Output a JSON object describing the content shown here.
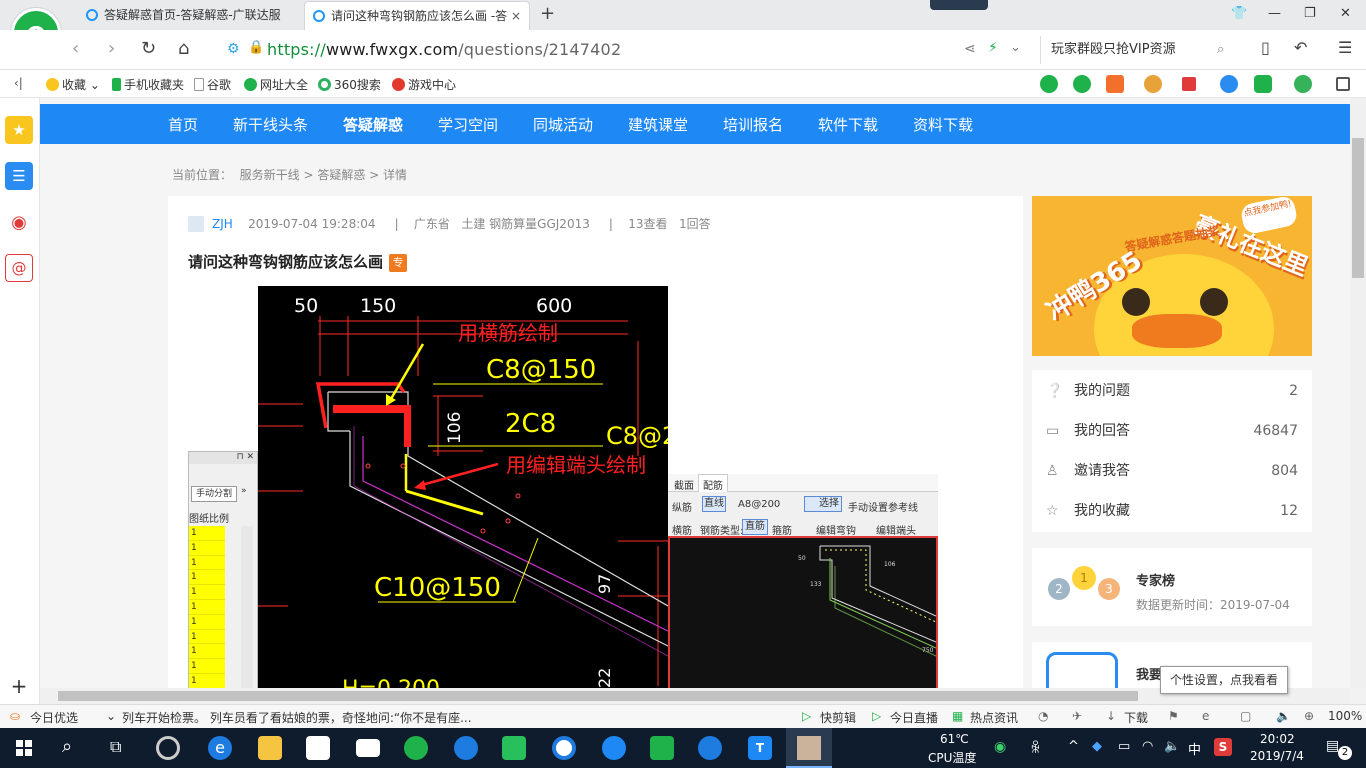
{
  "browser": {
    "tabs": [
      {
        "title": "答疑解惑首页-答疑解惑-广联达服"
      },
      {
        "title": "请问这种弯钩钢筋应该怎么画 -答"
      }
    ],
    "url_scheme": "https://",
    "url_domain": "www.fwxgx.com",
    "url_path": "/questions/2147402",
    "search_text": "玩家群殴只抢VIP资源",
    "favorites": [
      "收藏",
      "手机收藏夹",
      "谷歌",
      "网址大全",
      "360搜索",
      "游戏中心"
    ]
  },
  "site_nav": [
    "首页",
    "新干线头条",
    "答疑解惑",
    "学习空间",
    "同城活动",
    "建筑课堂",
    "培训报名",
    "软件下载",
    "资料下载"
  ],
  "breadcrumb": {
    "label": "当前位置：",
    "path": "服务新干线 > 答疑解惑 > 详情"
  },
  "question": {
    "author": "ZJH",
    "datetime": "2019-07-04 19:28:04",
    "location": "广东省",
    "category": "土建 钢筋算量GGJ2013",
    "views": "13查看",
    "answers": "1回答",
    "title": "请问这种弯钩钢筋应该怎么画",
    "badge": "专"
  },
  "cad": {
    "dim_50": "50",
    "dim_150": "150",
    "dim_600": "600",
    "note1": "用横筋绘制",
    "label_c8_150": "C8@150",
    "label_106": "106",
    "label_2c8": "2C8",
    "label_c8_2": "C8@2",
    "note2": "用编辑端头绘制",
    "label_c10": "C10@150",
    "label_97": "97",
    "label_22": "22",
    "label_h": "H=0.200",
    "panel_btn": "手动分割",
    "panel_col": "图纸比例",
    "panel_rows": [
      "1",
      "1",
      "1",
      "1",
      "1",
      "1",
      "1",
      "1",
      "1",
      "1",
      "1",
      "1"
    ],
    "sw_tabs": [
      "截面",
      "配筋"
    ],
    "sw_row1": {
      "lbl": "纵筋",
      "btn": "直线",
      "val": "A8@200",
      "select": "选择",
      "ref": "手动设置参考线"
    },
    "sw_row2": {
      "lbl": "横筋",
      "type": "钢筋类型:",
      "t1": "直筋",
      "t2": "箍筋",
      "e1": "编辑弯钩",
      "e2": "编辑端头"
    },
    "sw_dims": [
      "50",
      "106",
      "133",
      "750"
    ]
  },
  "ad": {
    "line1": "冲鸭365",
    "line2": "豪礼在这里",
    "line3": "答疑解惑答题抽奖",
    "badge": "点我参加鸭!"
  },
  "user_menu": [
    {
      "label": "我的问题",
      "count": "2",
      "icon": "question-icon"
    },
    {
      "label": "我的回答",
      "count": "46847",
      "icon": "comment-icon"
    },
    {
      "label": "邀请我答",
      "count": "804",
      "icon": "user-icon"
    },
    {
      "label": "我的收藏",
      "count": "12",
      "icon": "star-icon"
    }
  ],
  "expert": {
    "title": "专家榜",
    "updated": "数据更新时间：2019-07-04",
    "ranks": [
      "2",
      "1",
      "3"
    ]
  },
  "expert2": {
    "title": "我要"
  },
  "tooltip": "个性设置，点我看看",
  "statusbar": {
    "left": "今日优选",
    "news": "列车开始检票。 列车员看了看姑娘的票，奇怪地问:“你不是有座...",
    "items": [
      "快剪辑",
      "今日直播",
      "热点资讯",
      "下载"
    ],
    "zoom": "100%"
  },
  "taskbar": {
    "temp": "61℃",
    "temp_label": "CPU温度",
    "ime": "中",
    "time": "20:02",
    "date": "2019/7/4",
    "notif": "2"
  },
  "colors": {
    "nav_blue": "#1e88f5",
    "accent_green": "#1fb24a",
    "ad_yellow": "#f7b531"
  }
}
